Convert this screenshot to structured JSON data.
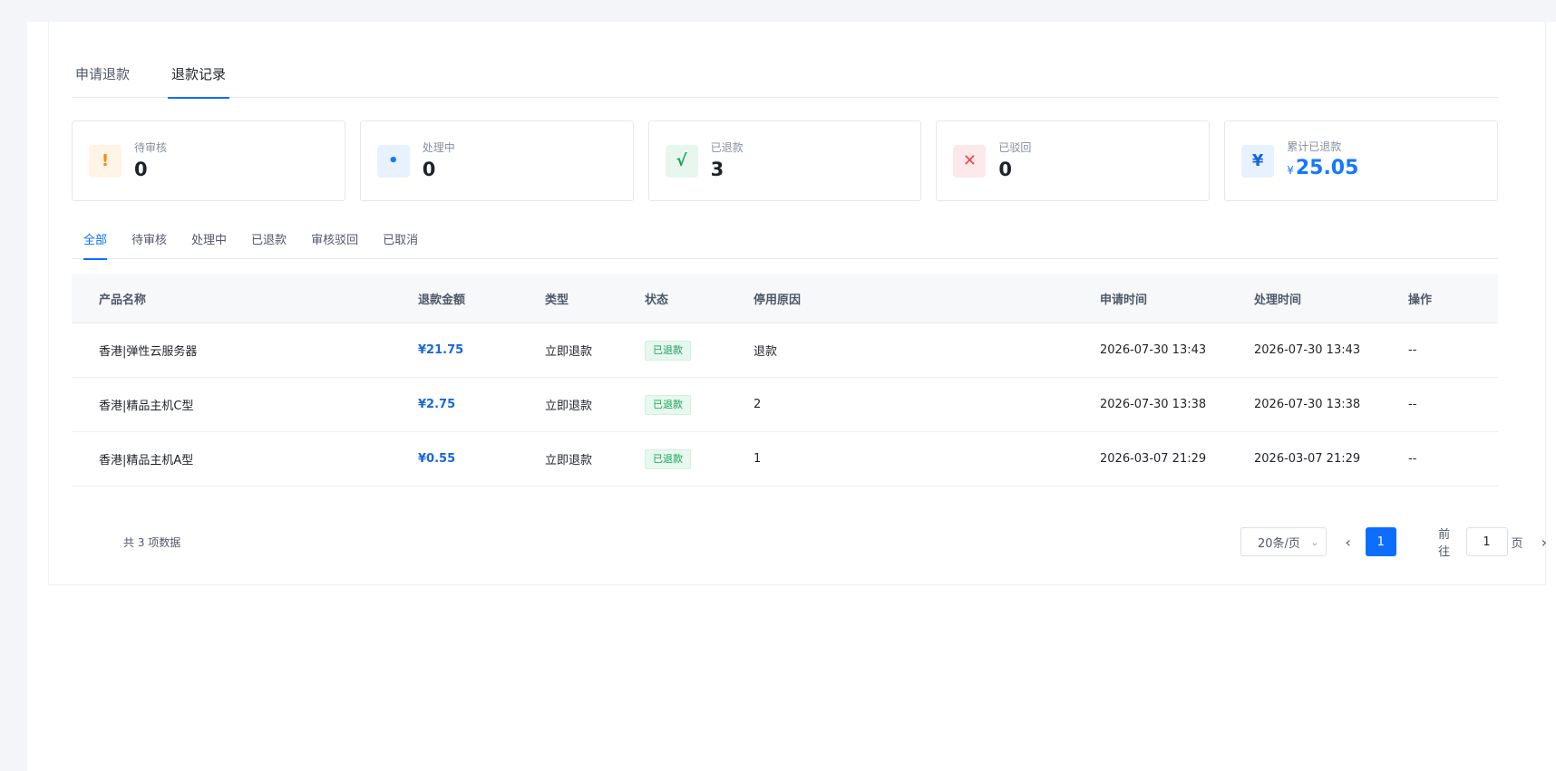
{
  "top_tabs": [
    {
      "label": "申请退款"
    },
    {
      "label": "退款记录",
      "active": true
    }
  ],
  "stats": {
    "pending": {
      "label": "待审核",
      "value": "0",
      "icon": "!"
    },
    "processing": {
      "label": "处理中",
      "value": "0",
      "icon": "•"
    },
    "refunded": {
      "label": "已退款",
      "value": "3",
      "icon": "√"
    },
    "rejected": {
      "label": "已驳回",
      "value": "0",
      "icon": "✕"
    },
    "total": {
      "label": "累计已退款",
      "currency": "¥",
      "value": "25.05",
      "icon": "¥"
    }
  },
  "filter_tabs": [
    "全部",
    "待审核",
    "处理中",
    "已退款",
    "审核驳回",
    "已取消"
  ],
  "table": {
    "headers": {
      "name": "产品名称",
      "amount": "退款金额",
      "type": "类型",
      "status": "状态",
      "reason": "停用原因",
      "apply_time": "申请时间",
      "process_time": "处理时间",
      "op": "操作"
    },
    "rows": [
      {
        "name": "香港|弹性云服务器",
        "amount": "¥21.75",
        "type": "立即退款",
        "status": "已退款",
        "reason": "退款",
        "apply_time": "2026-07-30 13:43",
        "process_time": "2026-07-30 13:43",
        "op": "--"
      },
      {
        "name": "香港|精品主机C型",
        "amount": "¥2.75",
        "type": "立即退款",
        "status": "已退款",
        "reason": "2",
        "apply_time": "2026-07-30 13:38",
        "process_time": "2026-07-30 13:38",
        "op": "--"
      },
      {
        "name": "香港|精品主机A型",
        "amount": "¥0.55",
        "type": "立即退款",
        "status": "已退款",
        "reason": "1",
        "apply_time": "2026-03-07 21:29",
        "process_time": "2026-03-07 21:29",
        "op": "--"
      }
    ]
  },
  "pagination": {
    "total_text": "共 3 项数据",
    "page_size": "20条/页",
    "current_page": "1",
    "goto_label": "前往",
    "goto_value": "1",
    "page_unit": "页",
    "prev_icon": "‹",
    "next_icon": "›"
  },
  "colors": {
    "accent": "#0d6efd",
    "success": "#16a35a",
    "warning": "#f58a07",
    "danger": "#e5484d"
  }
}
